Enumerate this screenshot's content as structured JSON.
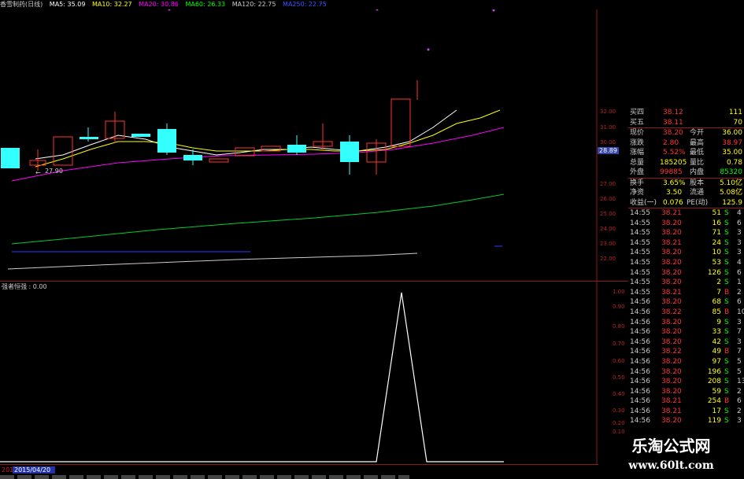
{
  "header": {
    "stock_title": "香雪制药(日线)",
    "ma5": "MA5: 35.09",
    "ma10": "MA10: 32.27",
    "ma20": "MA20: 30.86",
    "ma60": "MA60: 26.33",
    "ma120": "MA120: 22.75",
    "ma250": "MA250: 22.75"
  },
  "colors": {
    "ma5": "#ffffff",
    "ma10": "#ffff00",
    "ma20": "#ff00ff",
    "ma60": "#00ff00",
    "ma120": "#cccccc",
    "ma250": "#3355ff",
    "up": "#ff3333",
    "down": "#33ffff"
  },
  "price_axis": {
    "labels": [
      "32.00",
      "31.00",
      "30.00",
      "28.89",
      "27.00",
      "26.00",
      "25.00",
      "24.00",
      "23.00",
      "22.00"
    ]
  },
  "low_marker": "27.90",
  "indicator": {
    "title": "强者恒强 : 0.00",
    "axis_labels": [
      "1.00",
      "0.90",
      "0.80",
      "0.70",
      "0.60",
      "0.50",
      "0.40",
      "0.30",
      "0.20",
      "0.10"
    ]
  },
  "bottom": {
    "date_label": "2015/04/20",
    "left_text": "201"
  },
  "quote": {
    "rows": [
      {
        "l": "买四",
        "v": "38.12",
        "n": "",
        "v2": "111"
      },
      {
        "l": "买五",
        "v": "38.11",
        "n": "",
        "v2": "70"
      },
      {
        "l": "现价",
        "v": "38.20",
        "n": "今开",
        "v2": "36.00"
      },
      {
        "l": "涨跌",
        "v": "2.80",
        "n": "最高",
        "v2": "38.97"
      },
      {
        "l": "涨幅",
        "v": "5.52%",
        "n": "最低",
        "v2": "35.00"
      },
      {
        "l": "总量",
        "v": "185205",
        "n": "量比",
        "v2": "0.78"
      },
      {
        "l": "外盘",
        "v": "99885",
        "n": "内盘",
        "v2": "85320"
      },
      {
        "l": "换手",
        "v": "3.65%",
        "n": "股本",
        "v2": "5.10亿"
      },
      {
        "l": "净资",
        "v": "3.50",
        "n": "流通",
        "v2": "5.08亿"
      },
      {
        "l": "收益(一)",
        "v": "0.076",
        "n": "PE(动)",
        "v2": "125.9"
      }
    ]
  },
  "trades": [
    {
      "t": "14:55",
      "p": "38.21",
      "v": "51",
      "s": "S",
      "c": "4"
    },
    {
      "t": "14:55",
      "p": "38.20",
      "v": "16",
      "s": "S",
      "c": "6"
    },
    {
      "t": "14:55",
      "p": "38.20",
      "v": "71",
      "s": "S",
      "c": "3"
    },
    {
      "t": "14:55",
      "p": "38.21",
      "v": "24",
      "s": "S",
      "c": "3"
    },
    {
      "t": "14:55",
      "p": "38.20",
      "v": "10",
      "s": "S",
      "c": "3"
    },
    {
      "t": "14:55",
      "p": "38.20",
      "v": "53",
      "s": "S",
      "c": "4"
    },
    {
      "t": "14:55",
      "p": "38.20",
      "v": "126",
      "s": "S",
      "c": "6"
    },
    {
      "t": "14:55",
      "p": "38.20",
      "v": "2",
      "s": "S",
      "c": "1"
    },
    {
      "t": "14:55",
      "p": "38.21",
      "v": "7",
      "s": "B",
      "c": "2"
    },
    {
      "t": "14:56",
      "p": "38.20",
      "v": "68",
      "s": "S",
      "c": "6"
    },
    {
      "t": "14:56",
      "p": "38.22",
      "v": "85",
      "s": "B",
      "c": "10"
    },
    {
      "t": "14:56",
      "p": "38.20",
      "v": "9",
      "s": "S",
      "c": "3"
    },
    {
      "t": "14:56",
      "p": "38.20",
      "v": "33",
      "s": "S",
      "c": "7"
    },
    {
      "t": "14:56",
      "p": "38.20",
      "v": "42",
      "s": "S",
      "c": "3"
    },
    {
      "t": "14:56",
      "p": "38.22",
      "v": "49",
      "s": "B",
      "c": "7"
    },
    {
      "t": "14:56",
      "p": "38.20",
      "v": "97",
      "s": "S",
      "c": "5"
    },
    {
      "t": "14:56",
      "p": "38.20",
      "v": "196",
      "s": "S",
      "c": "5"
    },
    {
      "t": "14:56",
      "p": "38.20",
      "v": "208",
      "s": "S",
      "c": "13"
    },
    {
      "t": "14:56",
      "p": "38.20",
      "v": "59",
      "s": "S",
      "c": "2"
    },
    {
      "t": "14:56",
      "p": "38.21",
      "v": "254",
      "s": "B",
      "c": "6"
    },
    {
      "t": "14:56",
      "p": "38.21",
      "v": "17",
      "s": "S",
      "c": "2"
    },
    {
      "t": "14:56",
      "p": "38.20",
      "v": "119",
      "s": "S",
      "c": "3"
    }
  ],
  "watermark": {
    "cn": "乐淘公式网",
    "url": "www.60lt.com"
  }
}
